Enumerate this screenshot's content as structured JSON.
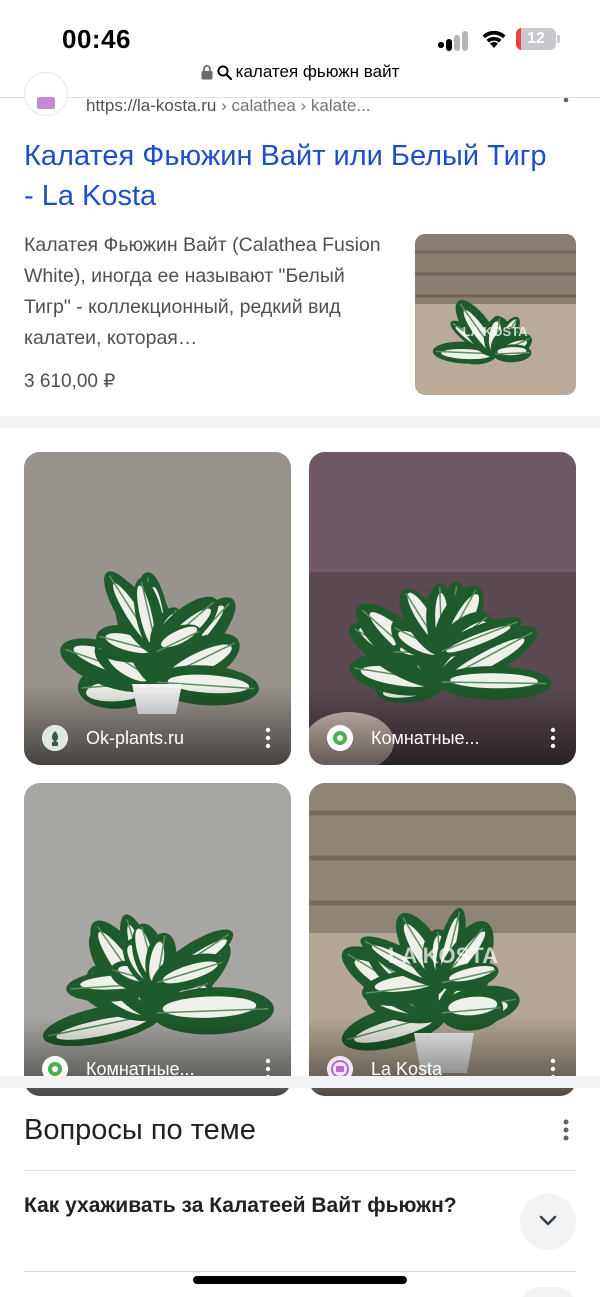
{
  "status_bar": {
    "time": "00:46",
    "battery": "12",
    "battery_level": 0.12
  },
  "browser": {
    "query": "калатея фьюжн вайт"
  },
  "result": {
    "url": "https://la-kosta.ru",
    "crumb_1": "calathea",
    "crumb_2": "kalate...",
    "title": "Калатея Фьюжин Вайт или Белый Тигр - La Kosta",
    "snippet": "Калатея Фьюжин Вайт (Calathea Fusion White), иногда ее называют \"Белый Тигр\" - коллекционный, редкий вид калатеи, которая…",
    "price": "3 610,00 ₽",
    "thumb_watermark": "LA KOSTA"
  },
  "images": [
    {
      "source": "Ok-plants.ru"
    },
    {
      "source": "Комнатные..."
    },
    {
      "source": "Комнатные..."
    },
    {
      "source": "La Kosta",
      "watermark": "LA KOSTA"
    }
  ],
  "questions": {
    "heading": "Вопросы по теме",
    "items": [
      {
        "text": "Как ухаживать за Калатеей Вайт фьюжн?"
      }
    ]
  },
  "colors": {
    "link": "#1f4fc8",
    "battery_low": "#e0463f",
    "separator": "#f1f3f4"
  }
}
